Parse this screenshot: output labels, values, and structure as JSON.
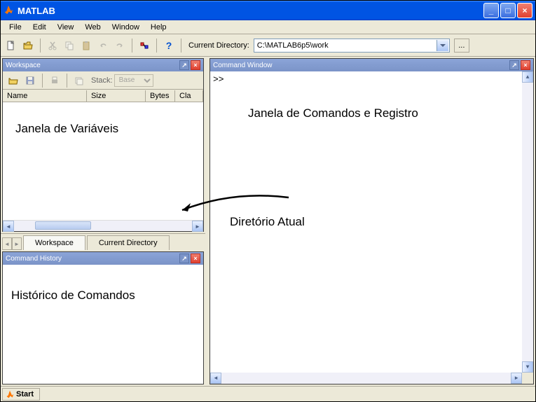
{
  "window": {
    "title": "MATLAB"
  },
  "menu": {
    "file": "File",
    "edit": "Edit",
    "view": "View",
    "web": "Web",
    "window": "Window",
    "help": "Help"
  },
  "toolbar": {
    "current_directory_label": "Current Directory:",
    "current_directory_value": "C:\\MATLAB6p5\\work",
    "stack_label": "Stack:",
    "stack_value": "Base"
  },
  "panels": {
    "workspace": {
      "title": "Workspace",
      "headers": {
        "name": "Name",
        "size": "Size",
        "bytes": "Bytes",
        "class": "Cla"
      },
      "annotation": "Janela de Variáveis"
    },
    "command_history": {
      "title": "Command History",
      "annotation": "Histórico de Comandos"
    },
    "command_window": {
      "title": "Command Window",
      "prompt": ">>",
      "annotation": "Janela de Comandos e Registro",
      "arrow_annotation": "Diretório Atual"
    }
  },
  "tabs": {
    "workspace": "Workspace",
    "current_directory": "Current Directory"
  },
  "statusbar": {
    "start": "Start"
  }
}
